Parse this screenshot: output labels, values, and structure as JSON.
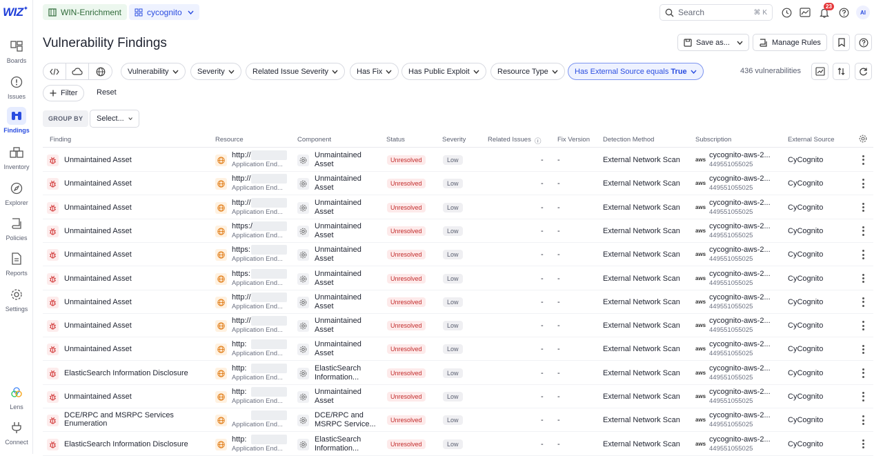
{
  "brand": {
    "logo": "WIZ",
    "accent": "#2a4de0"
  },
  "sidebar": {
    "items": [
      {
        "label": "Boards",
        "icon": "boards-icon"
      },
      {
        "label": "Issues",
        "icon": "issues-icon"
      },
      {
        "label": "Findings",
        "icon": "binoculars-icon",
        "active": true
      },
      {
        "label": "Inventory",
        "icon": "inventory-icon"
      },
      {
        "label": "Explorer",
        "icon": "compass-icon"
      },
      {
        "label": "Policies",
        "icon": "policies-icon"
      },
      {
        "label": "Reports",
        "icon": "reports-icon"
      },
      {
        "label": "Settings",
        "icon": "gear-icon"
      },
      {
        "label": "Lens",
        "icon": "lens-icon"
      },
      {
        "label": "Connect",
        "icon": "plug-icon"
      }
    ]
  },
  "topbar": {
    "environment": "WIN-Enrichment",
    "project": "cycognito",
    "search_placeholder": "Search",
    "search_shortcut": "⌘ K",
    "notification_count": "23",
    "avatar_initials": "AI"
  },
  "header": {
    "title": "Vulnerability Findings",
    "save_as": "Save as...",
    "manage_rules": "Manage Rules"
  },
  "filters": {
    "chips": [
      "Vulnerability",
      "Severity",
      "Related Issue Severity",
      "Has Fix",
      "Has Public Exploit",
      "Resource Type"
    ],
    "active_chip_prefix": "Has External Source equals ",
    "active_chip_value": "True",
    "count": "436 vulnerabilities",
    "add_filter": "Filter",
    "reset": "Reset",
    "group_by_label": "GROUP BY",
    "group_by_select": "Select..."
  },
  "table": {
    "columns": [
      "Finding",
      "Resource",
      "Component",
      "Status",
      "Severity",
      "Related Issues",
      "Fix Version",
      "Detection Method",
      "Subscription",
      "External Source"
    ],
    "rows": [
      {
        "finding": "Unmaintained Asset",
        "resource": "http://",
        "resource_type": "Application End...",
        "component": "Unmaintained",
        "component2": "Asset",
        "status": "Unresolved",
        "severity": "Low",
        "related": "-",
        "fix": "-",
        "detection": "External Network Scan",
        "subscription": "cycognito-aws-2...",
        "sub_id": "449551055025",
        "source": "CyCognito"
      },
      {
        "finding": "Unmaintained Asset",
        "resource": "http://",
        "resource_type": "Application End...",
        "component": "Unmaintained",
        "component2": "Asset",
        "status": "Unresolved",
        "severity": "Low",
        "related": "-",
        "fix": "-",
        "detection": "External Network Scan",
        "subscription": "cycognito-aws-2...",
        "sub_id": "449551055025",
        "source": "CyCognito"
      },
      {
        "finding": "Unmaintained Asset",
        "resource": "http://",
        "resource_type": "Application End...",
        "component": "Unmaintained",
        "component2": "Asset",
        "status": "Unresolved",
        "severity": "Low",
        "related": "-",
        "fix": "-",
        "detection": "External Network Scan",
        "subscription": "cycognito-aws-2...",
        "sub_id": "449551055025",
        "source": "CyCognito"
      },
      {
        "finding": "Unmaintained Asset",
        "resource": "https:/",
        "resource_type": "Application End...",
        "component": "Unmaintained",
        "component2": "Asset",
        "status": "Unresolved",
        "severity": "Low",
        "related": "-",
        "fix": "-",
        "detection": "External Network Scan",
        "subscription": "cycognito-aws-2...",
        "sub_id": "449551055025",
        "source": "CyCognito"
      },
      {
        "finding": "Unmaintained Asset",
        "resource": "https:",
        "resource_type": "Application End...",
        "component": "Unmaintained",
        "component2": "Asset",
        "status": "Unresolved",
        "severity": "Low",
        "related": "-",
        "fix": "-",
        "detection": "External Network Scan",
        "subscription": "cycognito-aws-2...",
        "sub_id": "449551055025",
        "source": "CyCognito"
      },
      {
        "finding": "Unmaintained Asset",
        "resource": "https:",
        "resource_type": "Application End...",
        "component": "Unmaintained",
        "component2": "Asset",
        "status": "Unresolved",
        "severity": "Low",
        "related": "-",
        "fix": "-",
        "detection": "External Network Scan",
        "subscription": "cycognito-aws-2...",
        "sub_id": "449551055025",
        "source": "CyCognito"
      },
      {
        "finding": "Unmaintained Asset",
        "resource": "http://",
        "resource_type": "Application End...",
        "component": "Unmaintained",
        "component2": "Asset",
        "status": "Unresolved",
        "severity": "Low",
        "related": "-",
        "fix": "-",
        "detection": "External Network Scan",
        "subscription": "cycognito-aws-2...",
        "sub_id": "449551055025",
        "source": "CyCognito"
      },
      {
        "finding": "Unmaintained Asset",
        "resource": "http://",
        "resource_type": "Application End...",
        "component": "Unmaintained",
        "component2": "Asset",
        "status": "Unresolved",
        "severity": "Low",
        "related": "-",
        "fix": "-",
        "detection": "External Network Scan",
        "subscription": "cycognito-aws-2...",
        "sub_id": "449551055025",
        "source": "CyCognito"
      },
      {
        "finding": "Unmaintained Asset",
        "resource": "http:",
        "resource_type": "Application End...",
        "component": "Unmaintained",
        "component2": "Asset",
        "status": "Unresolved",
        "severity": "Low",
        "related": "-",
        "fix": "-",
        "detection": "External Network Scan",
        "subscription": "cycognito-aws-2...",
        "sub_id": "449551055025",
        "source": "CyCognito"
      },
      {
        "finding": "ElasticSearch Information Disclosure",
        "resource": "http:",
        "resource_type": "Application End...",
        "component": "ElasticSearch",
        "component2": "Information...",
        "status": "Unresolved",
        "severity": "Low",
        "related": "-",
        "fix": "-",
        "detection": "External Network Scan",
        "subscription": "cycognito-aws-2...",
        "sub_id": "449551055025",
        "source": "CyCognito"
      },
      {
        "finding": "Unmaintained Asset",
        "resource": "http:",
        "resource_type": "Application End...",
        "component": "Unmaintained",
        "component2": "Asset",
        "status": "Unresolved",
        "severity": "Low",
        "related": "-",
        "fix": "-",
        "detection": "External Network Scan",
        "subscription": "cycognito-aws-2...",
        "sub_id": "449551055025",
        "source": "CyCognito"
      },
      {
        "finding": "DCE/RPC and MSRPC Services",
        "finding2": "Enumeration",
        "resource": "",
        "resource_type": "Application End...",
        "component": "DCE/RPC and",
        "component2": "MSRPC Service...",
        "status": "Unresolved",
        "severity": "Low",
        "related": "-",
        "fix": "-",
        "detection": "External Network Scan",
        "subscription": "cycognito-aws-2...",
        "sub_id": "449551055025",
        "source": "CyCognito"
      },
      {
        "finding": "ElasticSearch Information Disclosure",
        "resource": "http:",
        "resource_type": "Application End...",
        "component": "ElasticSearch",
        "component2": "Information...",
        "status": "Unresolved",
        "severity": "Low",
        "related": "-",
        "fix": "-",
        "detection": "External Network Scan",
        "subscription": "cycognito-aws-2...",
        "sub_id": "449551055025",
        "source": "CyCognito"
      }
    ]
  }
}
